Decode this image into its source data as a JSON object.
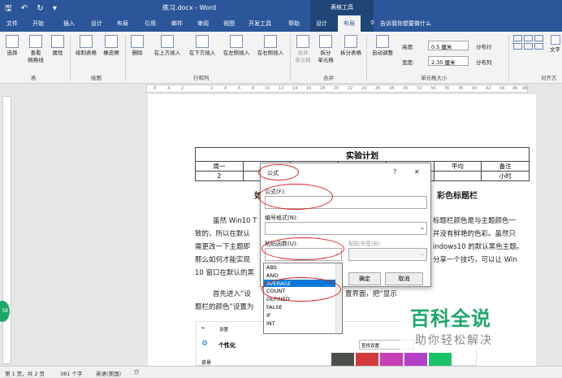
{
  "window": {
    "quick_access": "🖫 ↶ ↻ ▾",
    "title": "练习.docx - Word",
    "context_tab_group": "表格工具"
  },
  "tabs": [
    "文件",
    "开始",
    "插入",
    "设计",
    "布局",
    "引用",
    "邮件",
    "审阅",
    "视图",
    "开发工具",
    "帮助",
    "设计",
    "布局"
  ],
  "tell_me": "告诉我你想要做什么",
  "ribbon": {
    "buttons": {
      "select": "选择",
      "gridlines": "查看\n网格线",
      "properties": "属性",
      "draw_table": "绘制表格",
      "eraser": "橡皮擦",
      "delete": "删除",
      "insert_above": "在上方插入",
      "insert_below": "在下方插入",
      "insert_left": "在左侧插入",
      "insert_right": "在右侧插入",
      "merge_cells": "合并\n单元格",
      "split_cells": "拆分\n单元格",
      "split_table": "拆分表格",
      "autofit": "自动调整",
      "distribute_rows": "分布行",
      "distribute_cols": "分布列",
      "text_dir": "文字"
    },
    "groups": {
      "table": "表",
      "draw": "绘图",
      "rows_cols": "行和列",
      "merge": "合并",
      "cell_size": "单元格大小",
      "align": "对齐方"
    },
    "height_label": "高度:",
    "height_value": "0.5 厘米",
    "width_label": "宽度:",
    "width_value": "2.35 厘米"
  },
  "ruler_ticks": [
    "8",
    "4",
    "2",
    "2",
    "4",
    "6",
    "8",
    "10",
    "12",
    "14",
    "16",
    "18",
    "20",
    "22",
    "24",
    "26",
    "28",
    "30",
    "32",
    "34",
    "36",
    "38",
    "40",
    "42",
    "44",
    "46",
    "48"
  ],
  "document": {
    "table_title": "实验计划",
    "table_headers": [
      "周一",
      "周二",
      "周三",
      "周四",
      "周五",
      "平均",
      "备注"
    ],
    "table_row": [
      "2",
      "",
      "",
      "",
      "",
      "",
      "小时"
    ],
    "heading_visible_left": "如",
    "heading_visible_right": "彩色标题栏",
    "para1_left": [
      "虽然 Win10 T",
      "致的，所以在默认",
      "需更改一下主题即",
      "那么如何才能实现",
      "10 窗口在默认的黑"
    ],
    "para1_right": [
      "标题栏颜色是与主题颜色一",
      "并没有鲜艳的色彩。虽然只",
      "indows10 的默认黑色主题。",
      "分享一个技巧，可以让 Win",
      ""
    ],
    "para2_left": [
      "首先进入“设",
      "题栏的颜色”设置为"
    ],
    "para2_right": [
      "置界面，把“显示",
      ""
    ]
  },
  "dialog": {
    "title": "公式",
    "help": "?",
    "close": "✕",
    "formula_label": "公式(F):",
    "formula_value": "",
    "number_format_label": "编号格式(N):",
    "paste_function_label": "粘贴函数(U):",
    "paste_bookmark_label": "粘贴书签(B):",
    "ok": "确定",
    "cancel": "取消"
  },
  "function_list": {
    "items": [
      "ABS",
      "AND",
      "AVERAGE",
      "COUNT",
      "DEFINED",
      "FALSE",
      "IF",
      "INT"
    ],
    "selected": "AVERAGE"
  },
  "settings_preview": {
    "back": "←",
    "title": "设置",
    "section": "个性化",
    "search_placeholder": "查找设置",
    "background": "背景",
    "swatches": [
      "#4b4f4a",
      "#d43a3a",
      "#c63fb3",
      "#b33fc5",
      "#19c267"
    ]
  },
  "watermark": {
    "line1": "百科全说",
    "line2": "助你轻松解决"
  },
  "status": {
    "page": "第 1 页，共 2 页",
    "words": "381 个字",
    "lang": "英语(美国)",
    "icon": "🗊"
  },
  "colors": {
    "accent": "#2b579a",
    "annotation": "#e02020",
    "watermark_green": "#1ca868"
  }
}
